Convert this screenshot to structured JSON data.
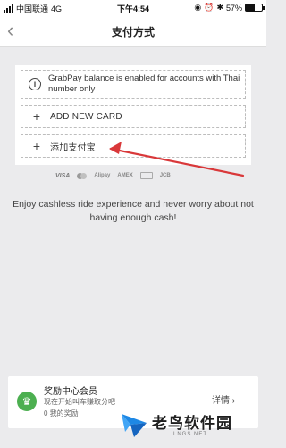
{
  "status_bar": {
    "carrier": "中国联通",
    "network": "4G",
    "time": "下午4:54",
    "battery": "57%",
    "battery_level": 0.57
  },
  "header": {
    "title": "支付方式",
    "back_icon": "chevron-left-icon"
  },
  "payment": {
    "notice": "GrabPay balance is enabled for accounts with Thai number only",
    "add_card_label": "ADD NEW CARD",
    "add_alipay_label": "添加支付宝"
  },
  "card_logos": [
    "VISA",
    "mastercard",
    "Alipay",
    "AMEX",
    "UnionPay",
    "JCB"
  ],
  "description": "Enjoy cashless ride experience and never worry about not having enough cash!",
  "rewards": {
    "title": "奖励中心会员",
    "subtitle": "现在开始叫车赚取分吧",
    "points": "0 我的奖励",
    "details_label": "详情 ›"
  },
  "watermark": {
    "brand": "老鸟软件园",
    "url": "LNGS.NET"
  },
  "colors": {
    "background": "#ebebed",
    "accent_red": "#d9383a",
    "rewards_green": "#4caf50"
  }
}
